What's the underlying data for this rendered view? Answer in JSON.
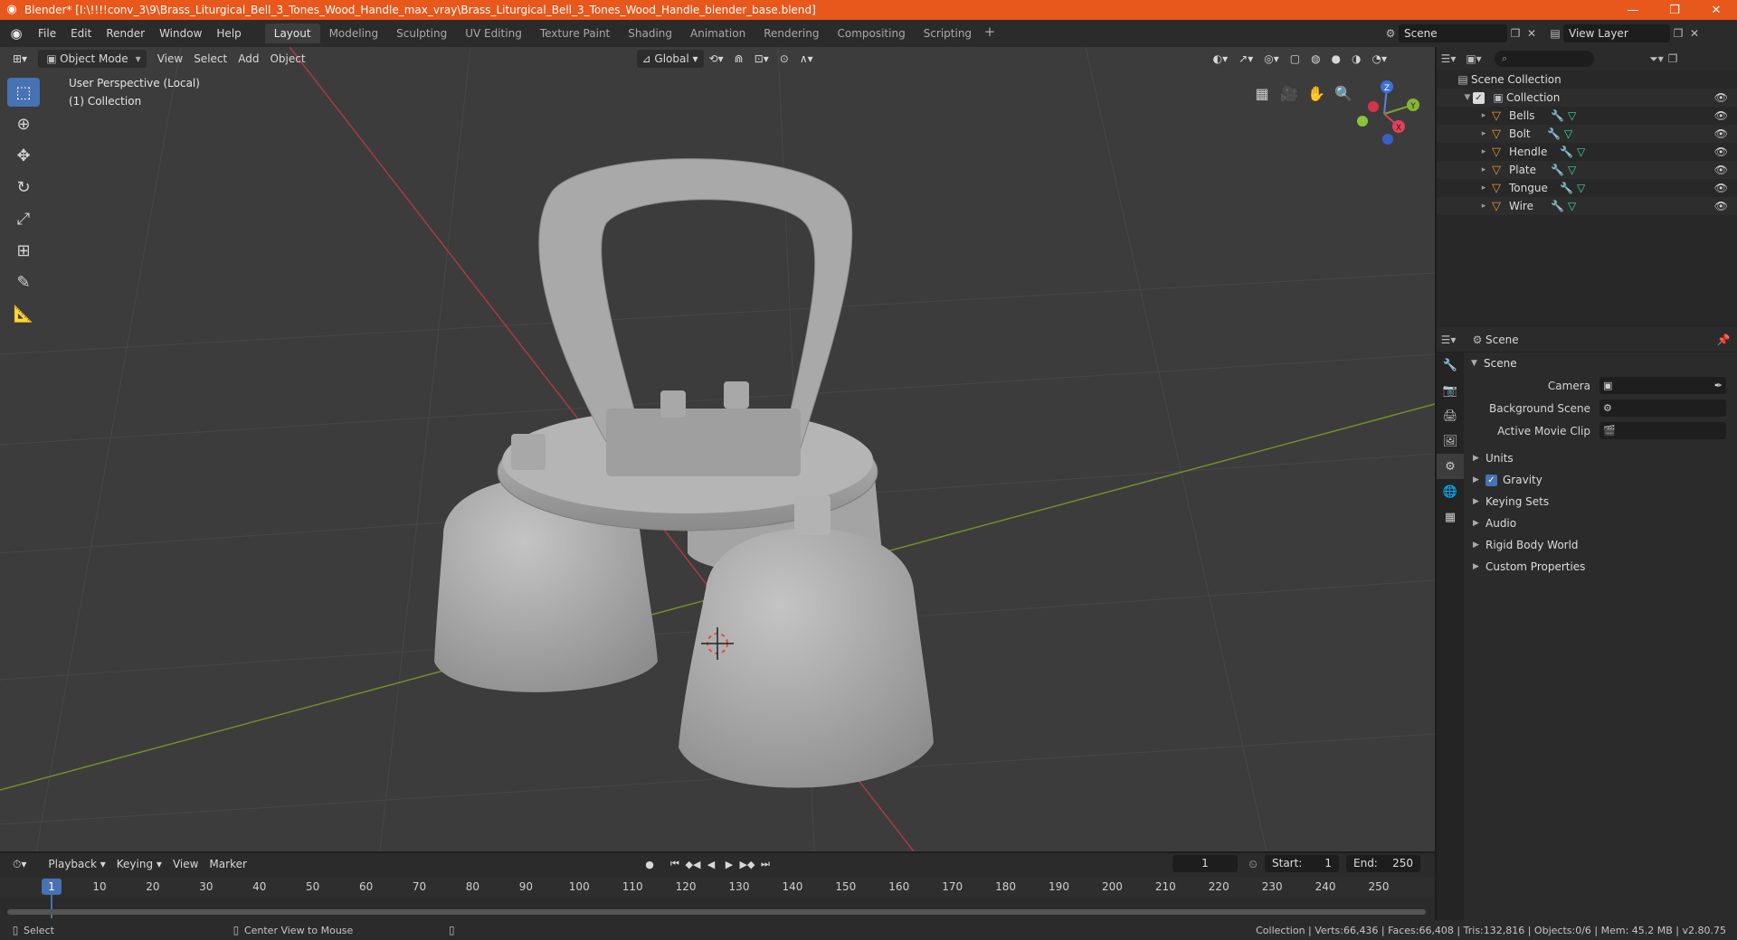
{
  "titlebar": {
    "title": "Blender* [I:\\!!!!conv_3\\9\\Brass_Liturgical_Bell_3_Tones_Wood_Handle_max_vray\\Brass_Liturgical_Bell_3_Tones_Wood_Handle_blender_base.blend]"
  },
  "menu": [
    "File",
    "Edit",
    "Render",
    "Window",
    "Help"
  ],
  "workspaces": [
    "Layout",
    "Modeling",
    "Sculpting",
    "UV Editing",
    "Texture Paint",
    "Shading",
    "Animation",
    "Rendering",
    "Compositing",
    "Scripting"
  ],
  "active_workspace": "Layout",
  "scene_name": "Scene",
  "view_layer": "View Layer",
  "viewport": {
    "mode": "Object Mode",
    "menus": [
      "View",
      "Select",
      "Add",
      "Object"
    ],
    "orientation": "Global",
    "perspective_label": "User Perspective (Local)",
    "collection_label": "(1) Collection",
    "gizmo": {
      "z": "Z",
      "y": "Y",
      "x": "X"
    }
  },
  "outliner": {
    "root": "Scene Collection",
    "collection": "Collection",
    "objects": [
      "Bells",
      "Bolt",
      "Hendle",
      "Plate",
      "Tongue",
      "Wire"
    ]
  },
  "properties": {
    "context": "Scene",
    "panel": "Scene",
    "camera_label": "Camera",
    "bg_scene_label": "Background Scene",
    "movie_clip_label": "Active Movie Clip",
    "subpanels": [
      "Units",
      "Gravity",
      "Keying Sets",
      "Audio",
      "Rigid Body World",
      "Custom Properties"
    ]
  },
  "timeline": {
    "menus": [
      "Playback",
      "Keying",
      "View",
      "Marker"
    ],
    "current_frame": "1",
    "start_label": "Start:",
    "start": "1",
    "end_label": "End:",
    "end": "250",
    "ticks": [
      "1",
      "10",
      "20",
      "30",
      "40",
      "50",
      "60",
      "70",
      "80",
      "90",
      "100",
      "110",
      "120",
      "130",
      "140",
      "150",
      "160",
      "170",
      "180",
      "190",
      "200",
      "210",
      "220",
      "230",
      "240",
      "250"
    ]
  },
  "statusbar": {
    "left": "Select",
    "middle": "Center View to Mouse",
    "right": "Collection | Verts:66,436 | Faces:66,408 | Tris:132,816 | Objects:0/6 | Mem: 45.2 MB | v2.80.75"
  }
}
